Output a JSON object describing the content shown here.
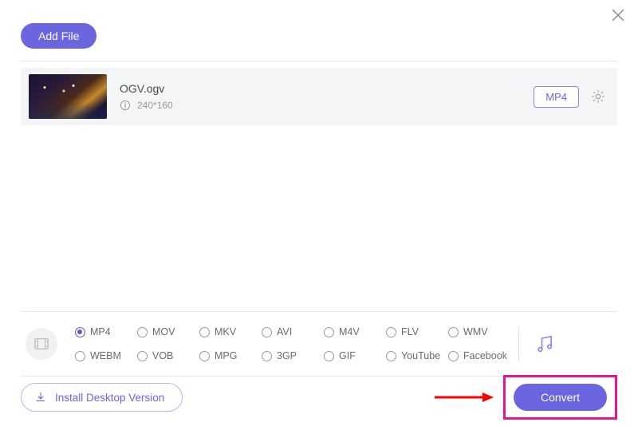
{
  "header": {
    "add_file_label": "Add File"
  },
  "file": {
    "name": "OGV.ogv",
    "resolution": "240*160",
    "format_badge": "MP4"
  },
  "formats": {
    "row1": [
      "MP4",
      "MOV",
      "MKV",
      "AVI",
      "M4V",
      "FLV",
      "WMV"
    ],
    "row2": [
      "WEBM",
      "VOB",
      "MPG",
      "3GP",
      "GIF",
      "YouTube",
      "Facebook"
    ],
    "selected": "MP4"
  },
  "footer": {
    "install_label": "Install Desktop Version",
    "convert_label": "Convert"
  }
}
